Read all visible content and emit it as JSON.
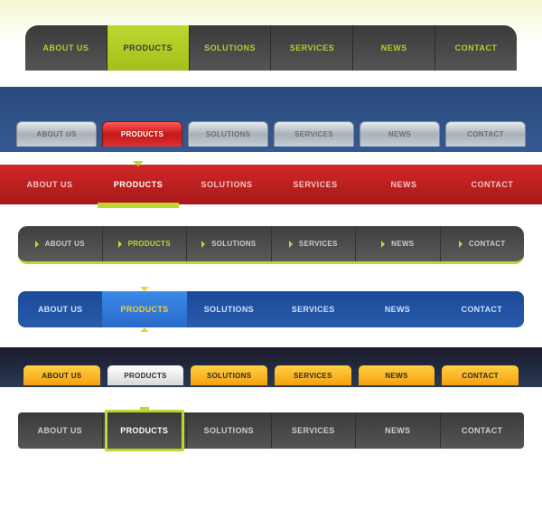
{
  "menus": [
    {
      "style": "dark-lime-tabs",
      "items": [
        "ABOUT US",
        "PRODUCTS",
        "SOLUTIONS",
        "SERVICES",
        "NEWS",
        "CONTACT"
      ],
      "active": 1
    },
    {
      "style": "silver-on-blue",
      "items": [
        "ABOUT US",
        "PRODUCTS",
        "SOLUTIONS",
        "SERVICES",
        "NEWS",
        "CONTACT"
      ],
      "active": 1
    },
    {
      "style": "red-bar-lime-marker",
      "items": [
        "ABOUT US",
        "PRODUCTS",
        "SOLUTIONS",
        "SERVICES",
        "NEWS",
        "CONTACT"
      ],
      "active": 1
    },
    {
      "style": "dark-arrow-underline",
      "items": [
        "ABOUT US",
        "PRODUCTS",
        "SOLUTIONS",
        "SERVICES",
        "NEWS",
        "CONTACT"
      ],
      "active": 1
    },
    {
      "style": "blue-bar-yellow-marker",
      "items": [
        "ABOUT US",
        "PRODUCTS",
        "SOLUTIONS",
        "SERVICES",
        "NEWS",
        "CONTACT"
      ],
      "active": 1
    },
    {
      "style": "orange-tabs-on-navy",
      "items": [
        "ABOUT US",
        "PRODUCTS",
        "SOLUTIONS",
        "SERVICES",
        "NEWS",
        "CONTACT"
      ],
      "active": 1
    },
    {
      "style": "dark-lime-outline",
      "items": [
        "ABOUT US",
        "PRODUCTS",
        "SOLUTIONS",
        "SERVICES",
        "NEWS",
        "CONTACT"
      ],
      "active": 1
    }
  ],
  "colors": {
    "lime": "#bdd730",
    "red": "#c41818",
    "blue": "#2a5aaa",
    "orange": "#f5a010",
    "navy": "#1a1a2a",
    "dark": "#3a3a3a"
  }
}
